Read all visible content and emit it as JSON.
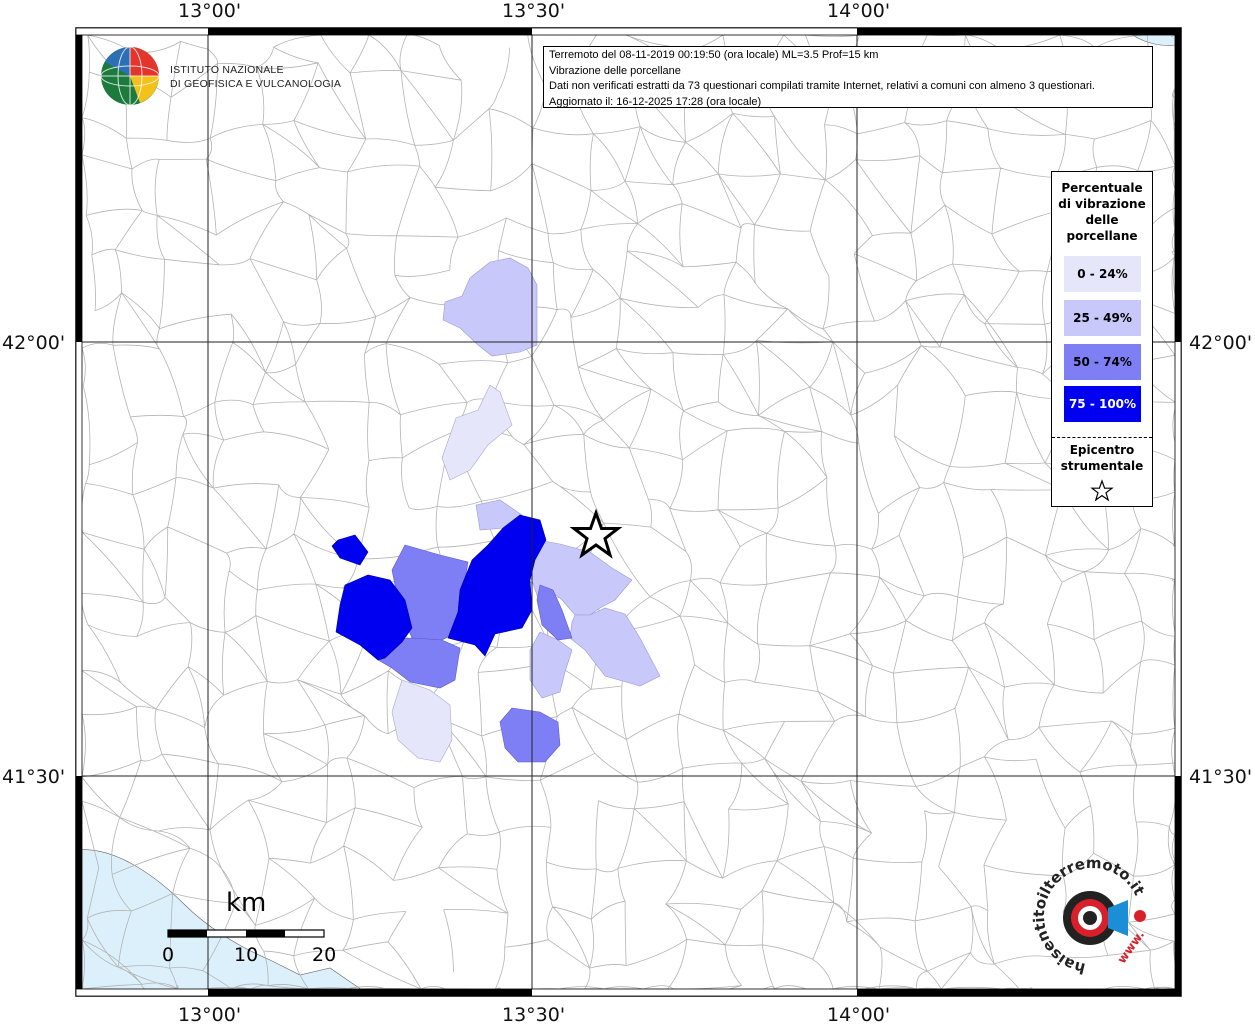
{
  "map": {
    "top_lon_labels": [
      "13°00'",
      "13°30'",
      "14°00'"
    ],
    "bottom_lon_labels": [
      "13°00'",
      "13°30'",
      "14°00'"
    ],
    "left_lat_labels": [
      "42°00'",
      "41°30'"
    ],
    "right_lat_labels": [
      "42°00'",
      "41°30'"
    ],
    "colors": {
      "sea": "#dcf0fb",
      "land": "#ffffff",
      "boundary": "#b4b4b4",
      "grid": "#222222",
      "class_0_24": "#e6e6fa",
      "class_25_49": "#c8c8fa",
      "class_50_74": "#7f7ff5",
      "class_75_100": "#0000f0"
    }
  },
  "info": {
    "line1": "Terremoto del 08-11-2019 00:19:50 (ora locale) ML=3.5 Prof=15 km",
    "line2": "Vibrazione delle porcellane",
    "line3": "Dati non verificati estratti da 73 questionari compilati tramite Internet, relativi a comuni con almeno 3 questionari.",
    "line4": "Aggiornato il: 16-12-2025 17:28 (ora locale)"
  },
  "legend": {
    "title": "Percentuale di vibrazione delle porcellane",
    "classes": [
      "0 - 24%",
      "25 - 49%",
      "50 - 74%",
      "75 - 100%"
    ],
    "epicenter_label": "Epicentro strumentale"
  },
  "logo": {
    "line1": "ISTITUTO NAZIONALE",
    "line2": "DI GEOFISICA E VULCANOLOGIA"
  },
  "scale": {
    "unit": "km",
    "ticks": [
      "0",
      "10",
      "20"
    ]
  },
  "hst_logo": {
    "text": "haisentitoilterremoto.it",
    "web_prefix": "www."
  }
}
